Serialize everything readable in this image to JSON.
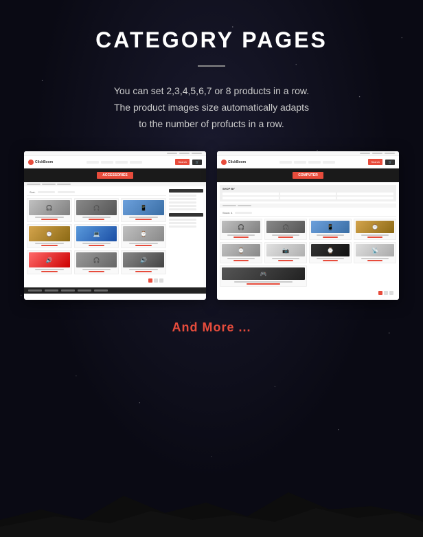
{
  "page": {
    "title": "CATEGORY PAGES",
    "divider": true,
    "description": "You can set 2,3,4,5,6,7 or 8 products in a row.\nThe product images size automatically adapts\nto the number of profucts in a row.",
    "and_more_label": "And More ...",
    "screenshots": [
      {
        "id": "screenshot-left",
        "alt": "Category page with sidebar layout"
      },
      {
        "id": "screenshot-right",
        "alt": "Category page with wider layout"
      }
    ]
  }
}
